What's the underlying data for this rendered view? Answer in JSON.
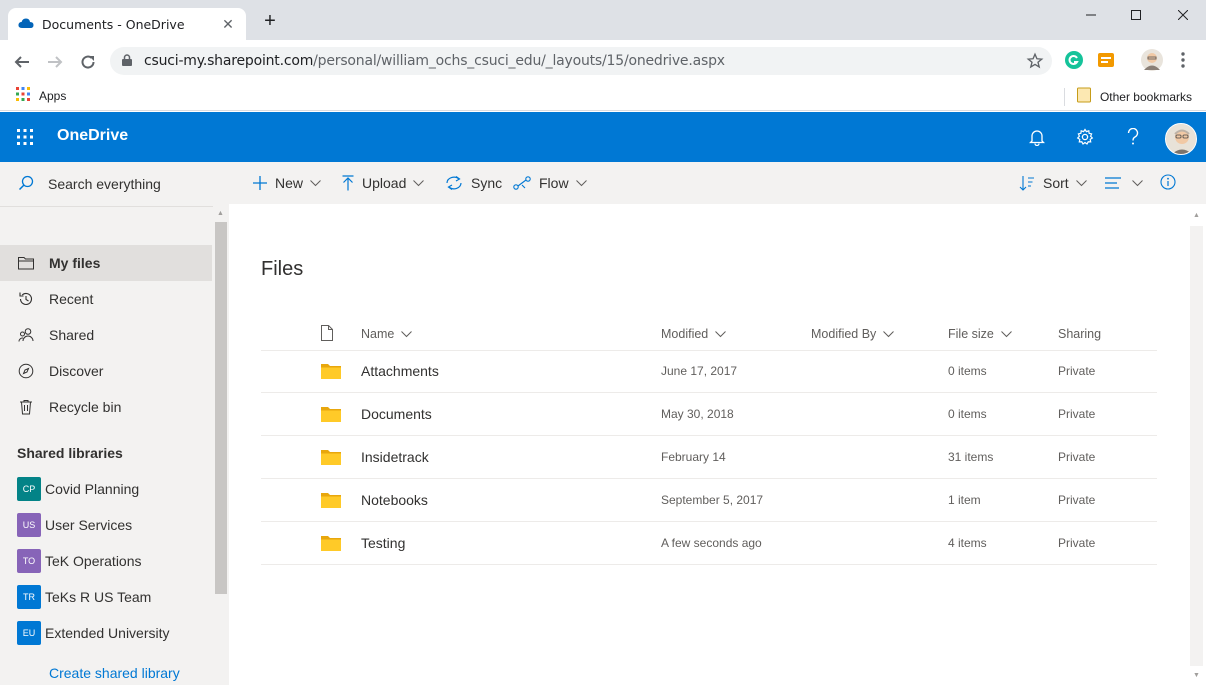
{
  "browser": {
    "tab_title": "Documents - OneDrive",
    "url_host": "csuci-my.sharepoint.com",
    "url_path": "/personal/william_ochs_csuci_edu/_layouts/15/onedrive.aspx",
    "bookmarks": {
      "apps_label": "Apps",
      "other_label": "Other bookmarks"
    }
  },
  "suite": {
    "brand": "OneDrive"
  },
  "leftnav": {
    "search_placeholder": "Search everything",
    "items": [
      {
        "label": "My files",
        "icon": "folder-icon"
      },
      {
        "label": "Recent",
        "icon": "history-icon"
      },
      {
        "label": "Shared",
        "icon": "people-icon"
      },
      {
        "label": "Discover",
        "icon": "compass-icon"
      },
      {
        "label": "Recycle bin",
        "icon": "trash-icon"
      }
    ],
    "shared_header": "Shared libraries",
    "libraries": [
      {
        "initials": "CP",
        "name": "Covid Planning",
        "color": "#038387"
      },
      {
        "initials": "US",
        "name": "User Services",
        "color": "#8764b8"
      },
      {
        "initials": "TO",
        "name": "TeK Operations",
        "color": "#8764b8"
      },
      {
        "initials": "TR",
        "name": "TeKs R US Team",
        "color": "#0078d4"
      },
      {
        "initials": "EU",
        "name": "Extended University",
        "color": "#0078d4"
      }
    ],
    "create_library": "Create shared library"
  },
  "commands": {
    "new": "New",
    "upload": "Upload",
    "sync": "Sync",
    "flow": "Flow",
    "sort": "Sort"
  },
  "main": {
    "title": "Files",
    "columns": {
      "name": "Name",
      "modified": "Modified",
      "modified_by": "Modified By",
      "file_size": "File size",
      "sharing": "Sharing"
    },
    "rows": [
      {
        "name": "Attachments",
        "modified": "June 17, 2017",
        "modified_by": "",
        "size": "0 items",
        "sharing": "Private"
      },
      {
        "name": "Documents",
        "modified": "May 30, 2018",
        "modified_by": "",
        "size": "0 items",
        "sharing": "Private"
      },
      {
        "name": "Insidetrack",
        "modified": "February 14",
        "modified_by": "",
        "size": "31 items",
        "sharing": "Private"
      },
      {
        "name": "Notebooks",
        "modified": "September 5, 2017",
        "modified_by": "",
        "size": "1 item",
        "sharing": "Private"
      },
      {
        "name": "Testing",
        "modified": "A few seconds ago",
        "modified_by": "",
        "size": "4 items",
        "sharing": "Private"
      }
    ]
  },
  "colors": {
    "accent": "#0078d4",
    "folder": "#ffb900",
    "nav_bg": "#f3f2f1"
  }
}
